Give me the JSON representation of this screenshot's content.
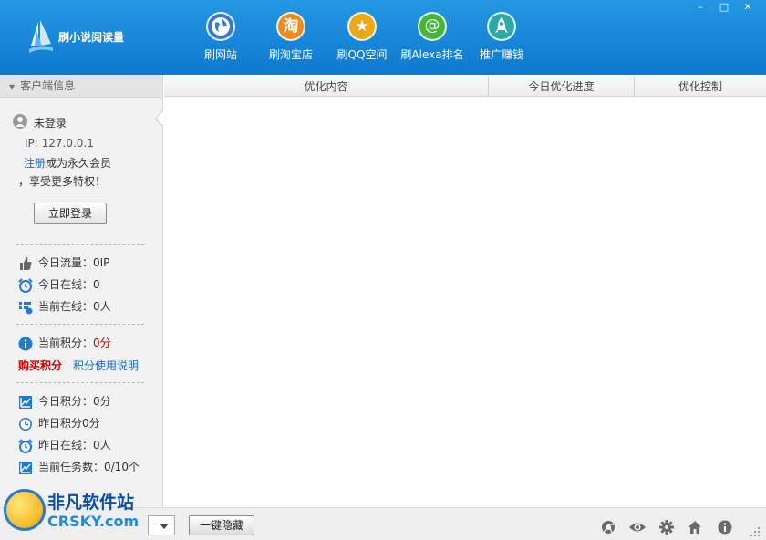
{
  "app": {
    "title": "刷小说阅读量",
    "window_controls": {
      "minimize": "–",
      "maximize": "□",
      "close": "✕"
    }
  },
  "toolbar": {
    "items": [
      {
        "label": "刷网站",
        "icon": "globe-icon",
        "color": "#3a78c9"
      },
      {
        "label": "刷淘宝店",
        "icon": "taobao-icon",
        "glyph": "淘",
        "color": "#f08a1c"
      },
      {
        "label": "刷QQ空间",
        "icon": "star-icon",
        "glyph": "★",
        "color": "#e9a91c"
      },
      {
        "label": "刷Alexa排名",
        "icon": "at-sign-icon",
        "glyph": "@",
        "color": "#47b53b"
      },
      {
        "label": "推广赚钱",
        "icon": "rocket-icon",
        "color": "#2fa9a6"
      }
    ]
  },
  "sidebar": {
    "header": "客户端信息",
    "user": {
      "status": "未登录",
      "ip": "IP: 127.0.0.1",
      "register_link": "注册",
      "register_suffix": "成为永久会员",
      "privilege": "，享受更多特权！",
      "login_button": "立即登录"
    },
    "stats_a": {
      "today_traffic": "今日流量：0IP",
      "today_online": "今日在线：0",
      "current_online": "当前在线：0人"
    },
    "points": {
      "label": "当前积分：",
      "value": "0分",
      "buy": "购买积分",
      "help": "积分使用说明"
    },
    "stats_b": {
      "today_points": "今日积分：0分",
      "yesterday_points": "昨日积分0分",
      "yesterday_online": "昨日在线：0人",
      "current_tasks": "当前任务数：0/10个"
    }
  },
  "table": {
    "columns": [
      "优化内容",
      "今日优化进度",
      "优化控制"
    ]
  },
  "footer": {
    "hide_button": "一键隐藏",
    "icons": [
      "chrome-icon",
      "eye-icon",
      "gear-icon",
      "home-icon",
      "info-icon"
    ]
  },
  "watermark": {
    "top": "非凡软件站",
    "bottom": "CRSKY.com"
  }
}
